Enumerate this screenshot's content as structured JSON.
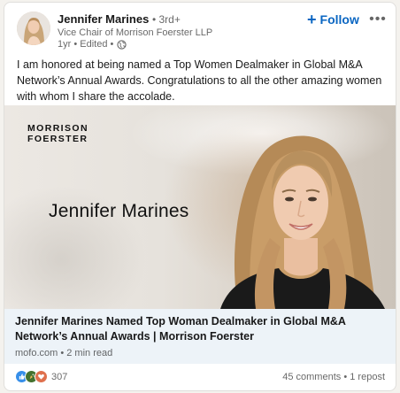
{
  "post": {
    "author": {
      "name": "Jennifer Marines",
      "degree": "• 3rd+",
      "headline": "Vice Chair of Morrison Foerster LLP",
      "time": "1yr • Edited •",
      "visibility_icon": "globe-icon"
    },
    "follow_label": "Follow",
    "more_label": "•••",
    "text": "I am honored at being named a Top Women Dealmaker in Global M&A Network’s Annual Awards. Congratulations to all the other amazing women with whom I share the accolade.",
    "media": {
      "logo_line1": "MORRISON",
      "logo_line2": "FOERSTER",
      "name": "Jennifer Marines"
    },
    "link": {
      "title": "Jennifer Marines Named Top Woman Dealmaker in Global M&A Network’s Annual Awards | Morrison Foerster",
      "subtitle": "mofo.com • 2 min read"
    },
    "social": {
      "reaction_icons": [
        "like-icon",
        "celebrate-icon",
        "love-icon"
      ],
      "reaction_count": "307",
      "comments": "45 comments",
      "separator": "•",
      "reposts": "1 repost"
    }
  },
  "colors": {
    "accent": "#0a66c2",
    "link_bg": "#edf3f8",
    "like": "#378fe9",
    "celebrate": "#44712e",
    "love": "#df704d"
  }
}
